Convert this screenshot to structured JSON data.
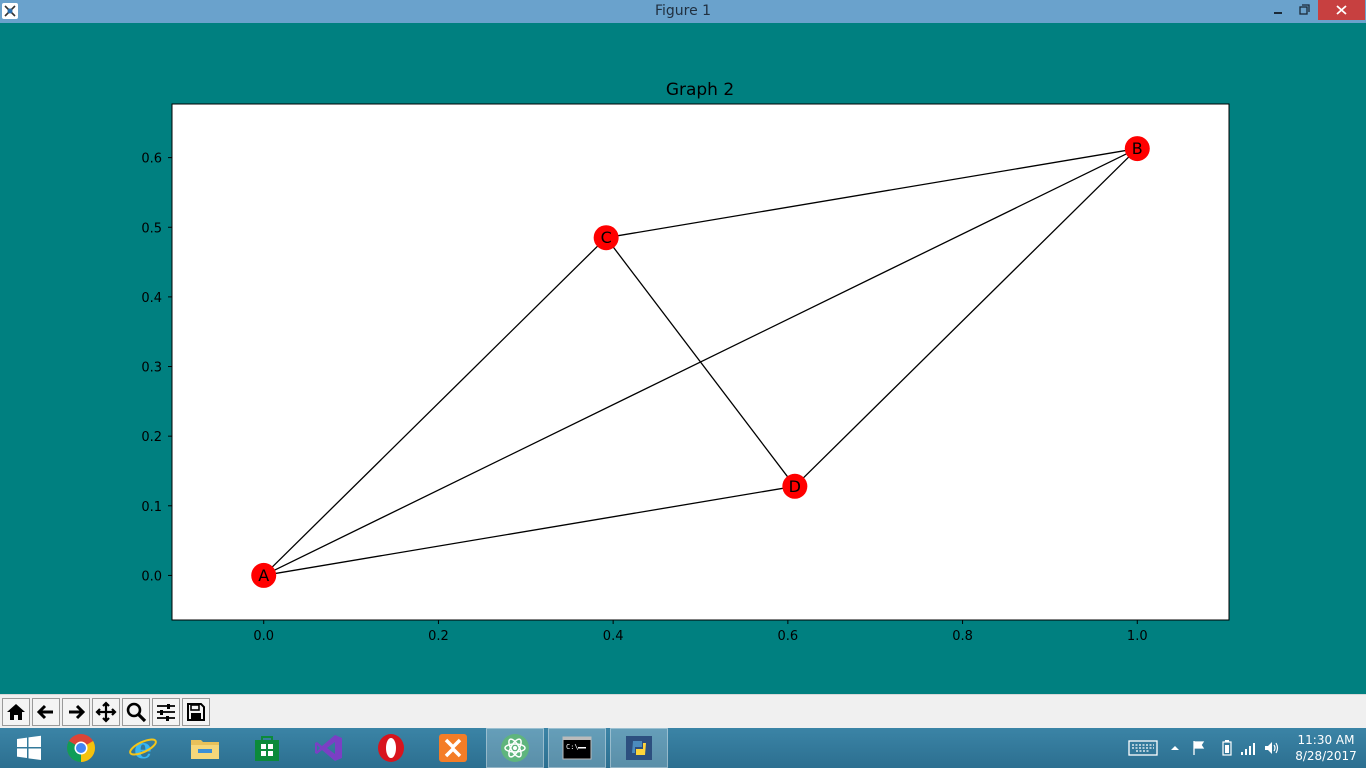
{
  "window": {
    "title": "Figure 1"
  },
  "chart_data": {
    "type": "scatter",
    "title": "Graph 2",
    "xlabel": "",
    "ylabel": "",
    "xlim": [
      -0.105,
      1.105
    ],
    "ylim": [
      -0.064,
      0.677
    ],
    "x_ticks": [
      "0.0",
      "0.2",
      "0.4",
      "0.6",
      "0.8",
      "1.0"
    ],
    "y_ticks": [
      "0.0",
      "0.1",
      "0.2",
      "0.3",
      "0.4",
      "0.5",
      "0.6"
    ],
    "grid": false,
    "nodes": [
      {
        "label": "A",
        "x": 0.0,
        "y": 0.0
      },
      {
        "label": "B",
        "x": 1.0,
        "y": 0.613
      },
      {
        "label": "C",
        "x": 0.392,
        "y": 0.485
      },
      {
        "label": "D",
        "x": 0.608,
        "y": 0.128
      }
    ],
    "edges": [
      [
        "A",
        "C"
      ],
      [
        "A",
        "B"
      ],
      [
        "A",
        "D"
      ],
      [
        "C",
        "B"
      ],
      [
        "C",
        "D"
      ],
      [
        "D",
        "B"
      ]
    ],
    "node_color": "#ff0000",
    "edge_color": "#000000",
    "face_color": "#ffffff",
    "background_color": "#008080"
  },
  "toolbar": {
    "buttons": [
      {
        "name": "home-button",
        "icon": "home-icon"
      },
      {
        "name": "back-button",
        "icon": "arrow-left-icon"
      },
      {
        "name": "forward-button",
        "icon": "arrow-right-icon"
      },
      {
        "name": "pan-button",
        "icon": "move-icon"
      },
      {
        "name": "zoom-button",
        "icon": "magnifier-icon"
      },
      {
        "name": "configure-subplots-button",
        "icon": "sliders-icon"
      },
      {
        "name": "save-button",
        "icon": "floppy-disk-icon"
      }
    ]
  },
  "taskbar": {
    "items": [
      {
        "name": "start-button",
        "icon": "windows-logo-icon"
      },
      {
        "name": "chrome",
        "icon": "chrome-icon"
      },
      {
        "name": "internet-explorer",
        "icon": "ie-icon"
      },
      {
        "name": "file-explorer",
        "icon": "folder-icon"
      },
      {
        "name": "store",
        "icon": "store-icon"
      },
      {
        "name": "visual-studio",
        "icon": "visual-studio-icon"
      },
      {
        "name": "opera",
        "icon": "opera-icon"
      },
      {
        "name": "xampp",
        "icon": "xampp-icon"
      },
      {
        "name": "atom",
        "icon": "atom-icon"
      },
      {
        "name": "command-prompt",
        "icon": "cmd-icon"
      },
      {
        "name": "python",
        "icon": "python-icon"
      }
    ],
    "clock_time": "11:30 AM",
    "clock_date": "8/28/2017"
  }
}
